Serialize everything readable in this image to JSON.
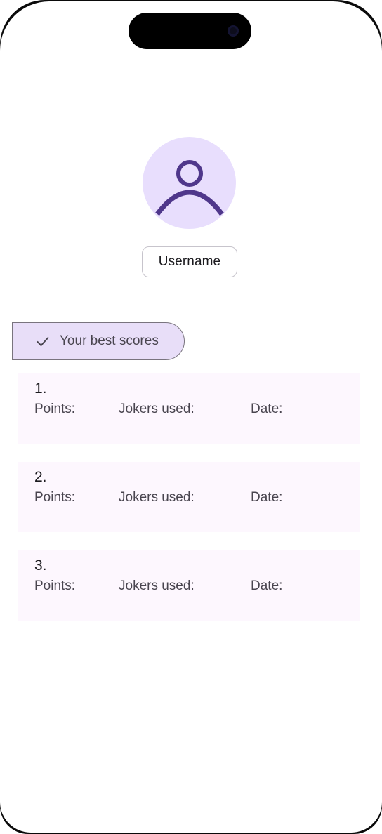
{
  "profile": {
    "avatar_icon": "person-icon",
    "username_label": "Username"
  },
  "scores_chip": {
    "icon": "check-icon",
    "label": "Your best scores"
  },
  "scores": [
    {
      "rank": "1.",
      "points_label": "Points:",
      "jokers_label": "Jokers used:",
      "date_label": "Date:"
    },
    {
      "rank": "2.",
      "points_label": "Points:",
      "jokers_label": "Jokers used:",
      "date_label": "Date:"
    },
    {
      "rank": "3.",
      "points_label": "Points:",
      "jokers_label": "Jokers used:",
      "date_label": "Date:"
    }
  ],
  "colors": {
    "accent": "#4f378b",
    "avatar_bg": "#e8defd",
    "chip_bg": "#e8def8",
    "card_bg": "#fdf7fe"
  }
}
